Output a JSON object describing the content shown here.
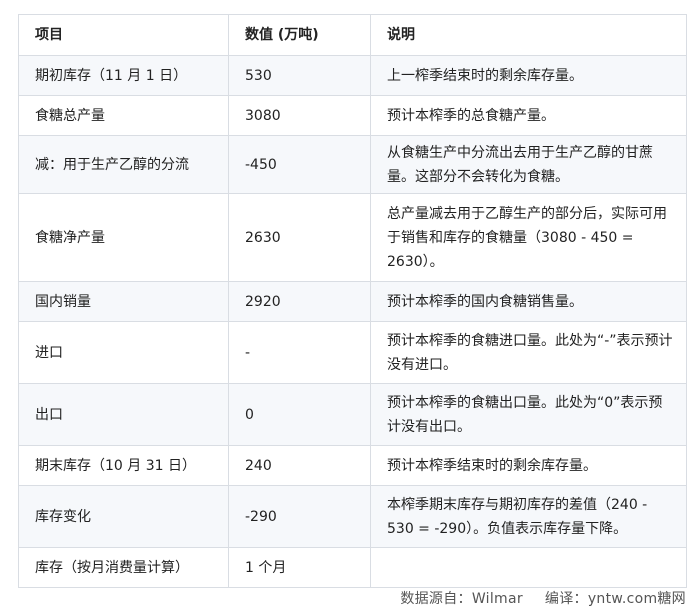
{
  "table": {
    "headers": [
      "项目",
      "数值 (万吨)",
      "说明"
    ],
    "rows": [
      [
        "期初库存（11 月 1 日）",
        "530",
        "上一榨季结束时的剩余库存量。"
      ],
      [
        "食糖总产量",
        "3080",
        "预计本榨季的总食糖产量。"
      ],
      [
        "减：用于生产乙醇的分流",
        "-450",
        "从食糖生产中分流出去用于生产乙醇的甘蔗量。这部分不会转化为食糖。"
      ],
      [
        "食糖净产量",
        "2630",
        "总产量减去用于乙醇生产的部分后，实际可用于销售和库存的食糖量（3080 - 450 = 2630）。"
      ],
      [
        "国内销量",
        "2920",
        "预计本榨季的国内食糖销售量。"
      ],
      [
        "进口",
        "-",
        "预计本榨季的食糖进口量。此处为“-”表示预计没有进口。"
      ],
      [
        "出口",
        "0",
        "预计本榨季的食糖出口量。此处为“0”表示预计没有出口。"
      ],
      [
        "期末库存（10 月 31 日）",
        "240",
        "预计本榨季结束时的剩余库存量。"
      ],
      [
        "库存变化",
        "-290",
        "本榨季期末库存与期初库存的差值（240 - 530 = -290）。负值表示库存量下降。"
      ],
      [
        "库存（按月消费量计算）",
        "1 个月",
        ""
      ]
    ]
  },
  "footer": {
    "source": "数据源自：Wilmar",
    "editor": "编译：yntw.com糖网"
  }
}
